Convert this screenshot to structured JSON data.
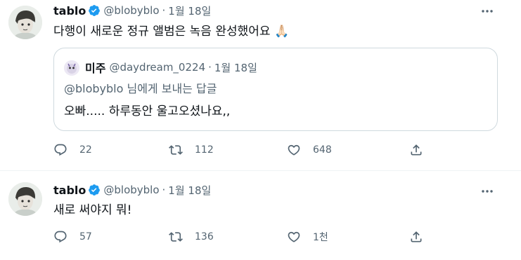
{
  "tweets": [
    {
      "name": "tablo",
      "handle": "@blobyblo",
      "separator": "·",
      "date": "1월 18일",
      "text": "다행이 새로운 정규 앨범은 녹음 완성했어요 🙏🏻",
      "quote": {
        "name": "미주",
        "handle": "@daydream_0224",
        "separator": "·",
        "date": "1월 18일",
        "mention": "@blobyblo",
        "reply_label": " 님에게 보내는 답글",
        "text": "오빠..... 하루동안 울고오셨나요,,"
      },
      "replies": "22",
      "retweets": "112",
      "likes": "648"
    },
    {
      "name": "tablo",
      "handle": "@blobyblo",
      "separator": "·",
      "date": "1월 18일",
      "text": "새로 써야지 뭐!",
      "replies": "57",
      "retweets": "136",
      "likes": "1천"
    }
  ],
  "icons": {
    "verified": "verified-badge-icon",
    "more": "more-options-icon",
    "reply": "reply-icon",
    "retweet": "retweet-icon",
    "like": "heart-icon",
    "share": "share-icon"
  },
  "colors": {
    "verified": "#1d9bf0",
    "secondary_text": "#536471",
    "border": "#cfd9de"
  }
}
